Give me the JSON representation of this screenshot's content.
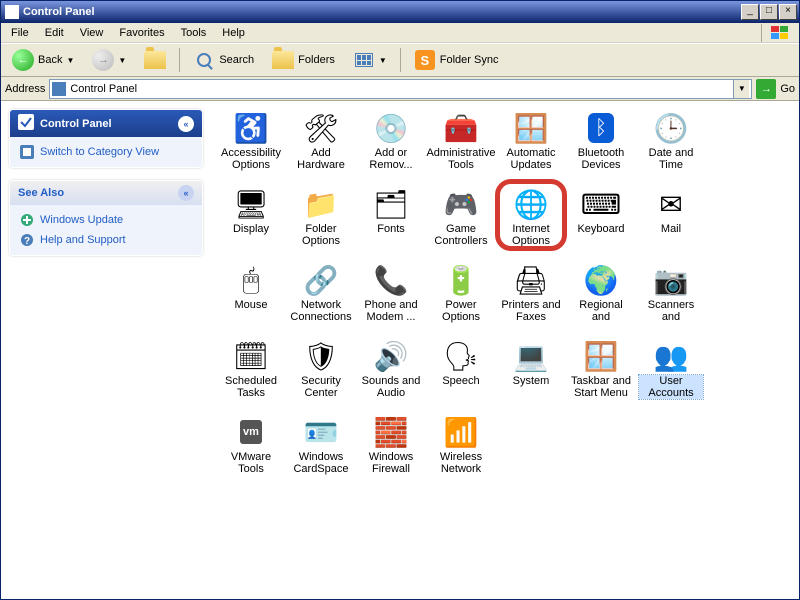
{
  "window": {
    "title": "Control Panel",
    "buttons": {
      "min": "_",
      "max": "□",
      "close": "×"
    }
  },
  "menu": {
    "items": [
      "File",
      "Edit",
      "View",
      "Favorites",
      "Tools",
      "Help"
    ]
  },
  "toolbar": {
    "back": "Back",
    "search": "Search",
    "folders": "Folders",
    "folder_sync": "Folder Sync"
  },
  "address": {
    "label": "Address",
    "value": "Control Panel",
    "go": "Go"
  },
  "sidebar": {
    "panel1": {
      "title": "Control Panel",
      "links": [
        {
          "label": "Switch to Category View",
          "icon": "category-view-icon"
        }
      ]
    },
    "panel2": {
      "title": "See Also",
      "links": [
        {
          "label": "Windows Update",
          "icon": "windows-update-icon"
        },
        {
          "label": "Help and Support",
          "icon": "help-icon"
        }
      ]
    }
  },
  "items": [
    {
      "label": "Accessibility Options",
      "icon": "♿",
      "highlight": false
    },
    {
      "label": "Add Hardware",
      "icon": "🛠",
      "highlight": false
    },
    {
      "label": "Add or Remov...",
      "icon": "💿",
      "highlight": false
    },
    {
      "label": "Administrative Tools",
      "icon": "🧰",
      "highlight": false
    },
    {
      "label": "Automatic Updates",
      "icon": "🪟",
      "highlight": false
    },
    {
      "label": "Bluetooth Devices",
      "icon": "ᛒ",
      "highlight": false
    },
    {
      "label": "Date and Time",
      "icon": "🕒",
      "highlight": false
    },
    {
      "label": "Display",
      "icon": "🖥",
      "highlight": false
    },
    {
      "label": "Folder Options",
      "icon": "📁",
      "highlight": false
    },
    {
      "label": "Fonts",
      "icon": "🗂",
      "highlight": false
    },
    {
      "label": "Game Controllers",
      "icon": "🎮",
      "highlight": false
    },
    {
      "label": "Internet Options",
      "icon": "🌐",
      "highlight": true
    },
    {
      "label": "Keyboard",
      "icon": "⌨",
      "highlight": false
    },
    {
      "label": "Mail",
      "icon": "✉",
      "highlight": false
    },
    {
      "label": "Mouse",
      "icon": "🖱",
      "highlight": false
    },
    {
      "label": "Network Connections",
      "icon": "🔗",
      "highlight": false
    },
    {
      "label": "Phone and Modem ...",
      "icon": "📞",
      "highlight": false
    },
    {
      "label": "Power Options",
      "icon": "🔋",
      "highlight": false
    },
    {
      "label": "Printers and Faxes",
      "icon": "🖨",
      "highlight": false
    },
    {
      "label": "Regional and Language ...",
      "icon": "🌍",
      "highlight": false
    },
    {
      "label": "Scanners and Cameras",
      "icon": "📷",
      "highlight": false
    },
    {
      "label": "Scheduled Tasks",
      "icon": "🗓",
      "highlight": false
    },
    {
      "label": "Security Center",
      "icon": "🛡",
      "highlight": false
    },
    {
      "label": "Sounds and Audio Devices",
      "icon": "🔊",
      "highlight": false
    },
    {
      "label": "Speech",
      "icon": "🗣",
      "highlight": false
    },
    {
      "label": "System",
      "icon": "💻",
      "highlight": false
    },
    {
      "label": "Taskbar and Start Menu",
      "icon": "🪟",
      "highlight": false
    },
    {
      "label": "User Accounts",
      "icon": "👥",
      "highlight": false,
      "selected": true
    },
    {
      "label": "VMware Tools",
      "icon": "vm",
      "highlight": false
    },
    {
      "label": "Windows CardSpace",
      "icon": "🪪",
      "highlight": false
    },
    {
      "label": "Windows Firewall",
      "icon": "🧱",
      "highlight": false
    },
    {
      "label": "Wireless Network Set...",
      "icon": "📶",
      "highlight": false
    }
  ],
  "first_row_count": 7,
  "cols": 8
}
